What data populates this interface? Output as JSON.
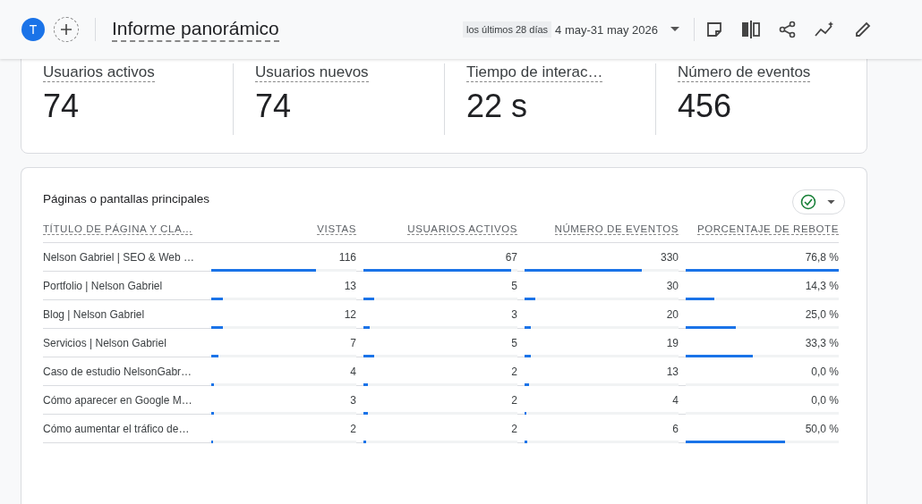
{
  "header": {
    "avatar": "T",
    "title": "Informe panorámico",
    "range_chip": "los últimos 28 días",
    "date_range": "4 may-31 may 2026"
  },
  "kpis": [
    {
      "label": "Usuarios activos",
      "value": "74"
    },
    {
      "label": "Usuarios nuevos",
      "value": "74"
    },
    {
      "label": "Tiempo de interac…",
      "value": "22 s"
    },
    {
      "label": "Número de eventos",
      "value": "456"
    }
  ],
  "table": {
    "title": "Páginas o pantallas principales",
    "status_ok": true,
    "columns": [
      "TÍTULO DE PÁGINA Y CLA…",
      "VISTAS",
      "USUARIOS ACTIVOS",
      "NÚMERO DE EVENTOS",
      "PORCENTAJE DE REBOTE"
    ],
    "rows": [
      {
        "cells": [
          {
            "value": "Nelson Gabriel | SEO & Web …"
          },
          {
            "value": "116",
            "level": 0.72
          },
          {
            "value": "67",
            "level": 0.96
          },
          {
            "value": "330",
            "level": 0.76
          },
          {
            "value": "76,8 %",
            "level": 1.0
          }
        ]
      },
      {
        "cells": [
          {
            "value": "Portfolio | Nelson Gabriel"
          },
          {
            "value": "13",
            "level": 0.08
          },
          {
            "value": "5",
            "level": 0.07
          },
          {
            "value": "30",
            "level": 0.07
          },
          {
            "value": "14,3 %",
            "level": 0.19
          }
        ]
      },
      {
        "cells": [
          {
            "value": "Blog | Nelson Gabriel"
          },
          {
            "value": "12",
            "level": 0.08
          },
          {
            "value": "3",
            "level": 0.04
          },
          {
            "value": "20",
            "level": 0.04
          },
          {
            "value": "25,0 %",
            "level": 0.33
          }
        ]
      },
      {
        "cells": [
          {
            "value": "Servicios | Nelson Gabriel"
          },
          {
            "value": "7",
            "level": 0.05
          },
          {
            "value": "5",
            "level": 0.07
          },
          {
            "value": "19",
            "level": 0.04
          },
          {
            "value": "33,3 %",
            "level": 0.44
          }
        ]
      },
      {
        "cells": [
          {
            "value": "Caso de estudio NelsonGabr…"
          },
          {
            "value": "4",
            "level": 0.02
          },
          {
            "value": "2",
            "level": 0.03
          },
          {
            "value": "13",
            "level": 0.03
          },
          {
            "value": "0,0 %"
          }
        ]
      },
      {
        "cells": [
          {
            "value": "Cómo aparecer en Google M…"
          },
          {
            "value": "3",
            "level": 0.02
          },
          {
            "value": "2",
            "level": 0.03
          },
          {
            "value": "4",
            "level": 0.01
          },
          {
            "value": "0,0 %"
          }
        ]
      },
      {
        "cells": [
          {
            "value": "Cómo aumentar el tráfico de…"
          },
          {
            "value": "2",
            "level": 0.015
          },
          {
            "value": "2",
            "level": 0.02
          },
          {
            "value": "6",
            "level": 0.015
          },
          {
            "value": "50,0 %",
            "level": 0.65
          }
        ]
      }
    ]
  }
}
